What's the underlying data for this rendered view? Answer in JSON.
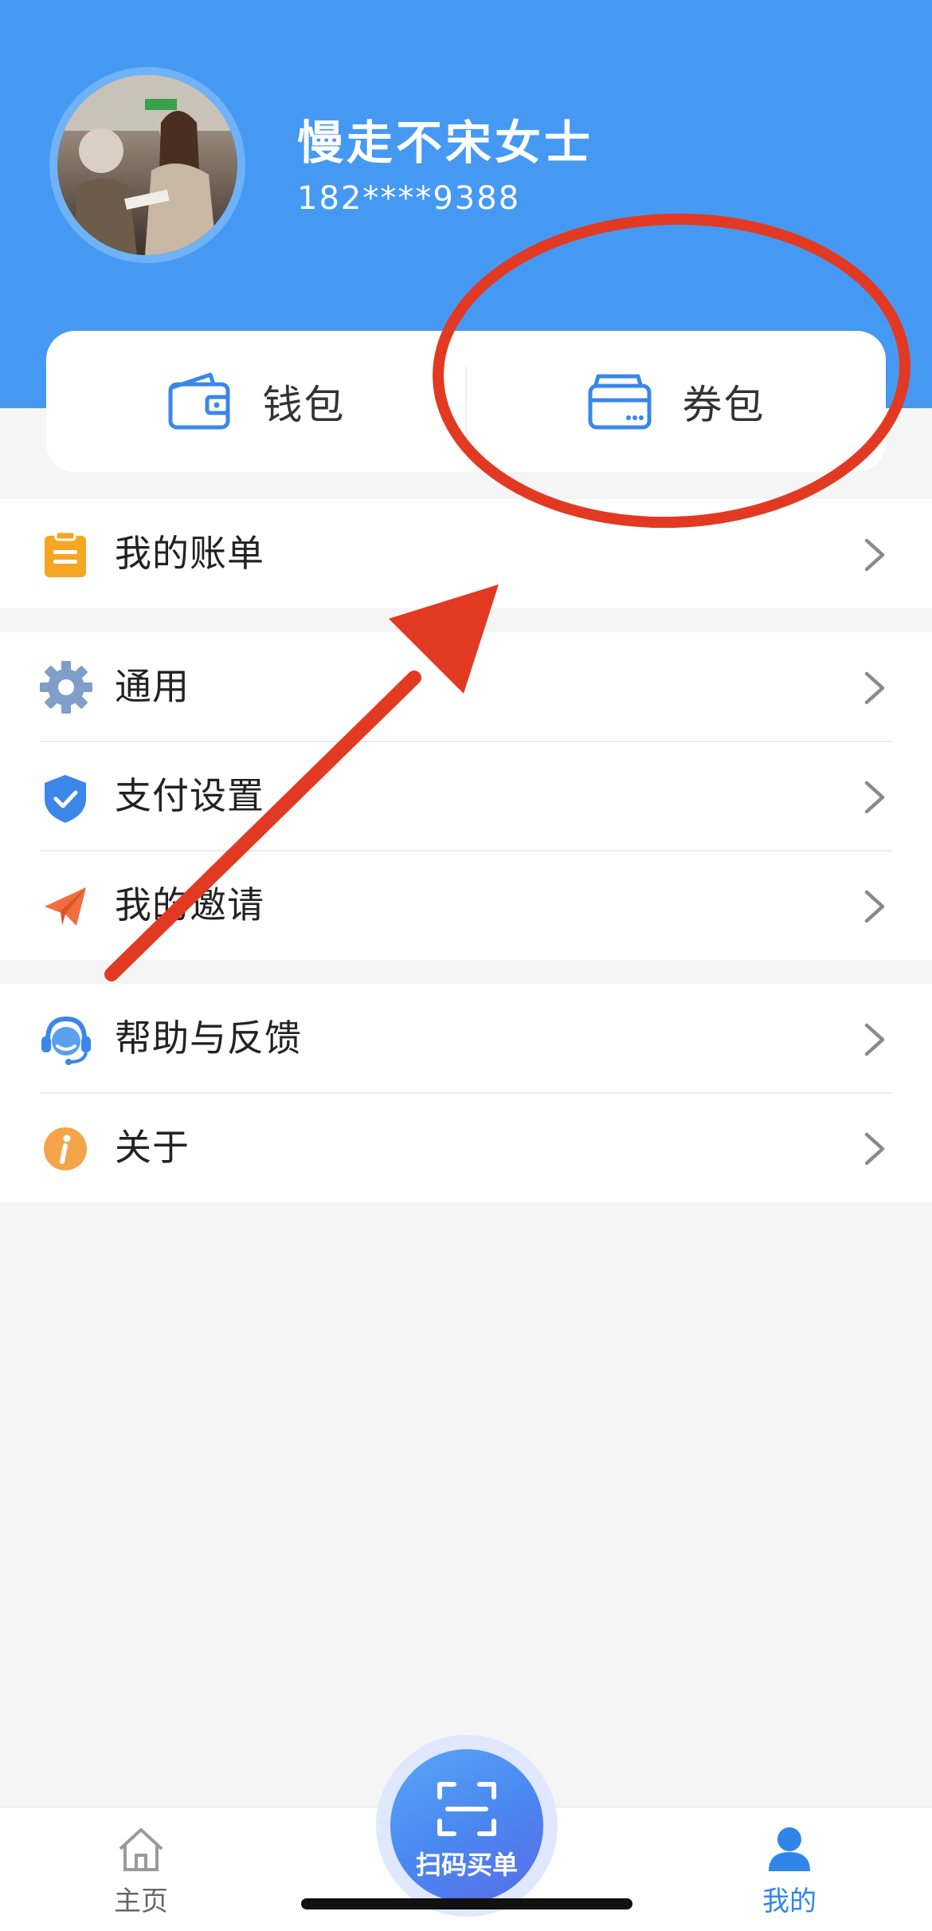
{
  "profile": {
    "name": "慢走不宋女士",
    "phone": "182****9388",
    "avatar_icon": "avatar-photo"
  },
  "wallet_card": {
    "wallet_label": "钱包",
    "coupon_label": "券包"
  },
  "menu": {
    "group1": [
      {
        "label": "我的账单",
        "icon": "bill-icon"
      }
    ],
    "group2": [
      {
        "label": "通用",
        "icon": "gear-icon"
      },
      {
        "label": "支付设置",
        "icon": "shield-check-icon"
      },
      {
        "label": "我的邀请",
        "icon": "paper-plane-icon"
      }
    ],
    "group3": [
      {
        "label": "帮助与反馈",
        "icon": "headset-icon"
      },
      {
        "label": "关于",
        "icon": "info-icon"
      }
    ]
  },
  "tabbar": {
    "home_label": "主页",
    "scan_label": "扫码买单",
    "mine_label": "我的",
    "active_tab": "mine"
  },
  "colors": {
    "header_blue": "#4699f3",
    "icon_blue": "#3a87e8",
    "annotation_red": "#e23a22",
    "bill_orange": "#f5a623",
    "invite_orange": "#f26d3d",
    "info_orange": "#f4a54a"
  }
}
